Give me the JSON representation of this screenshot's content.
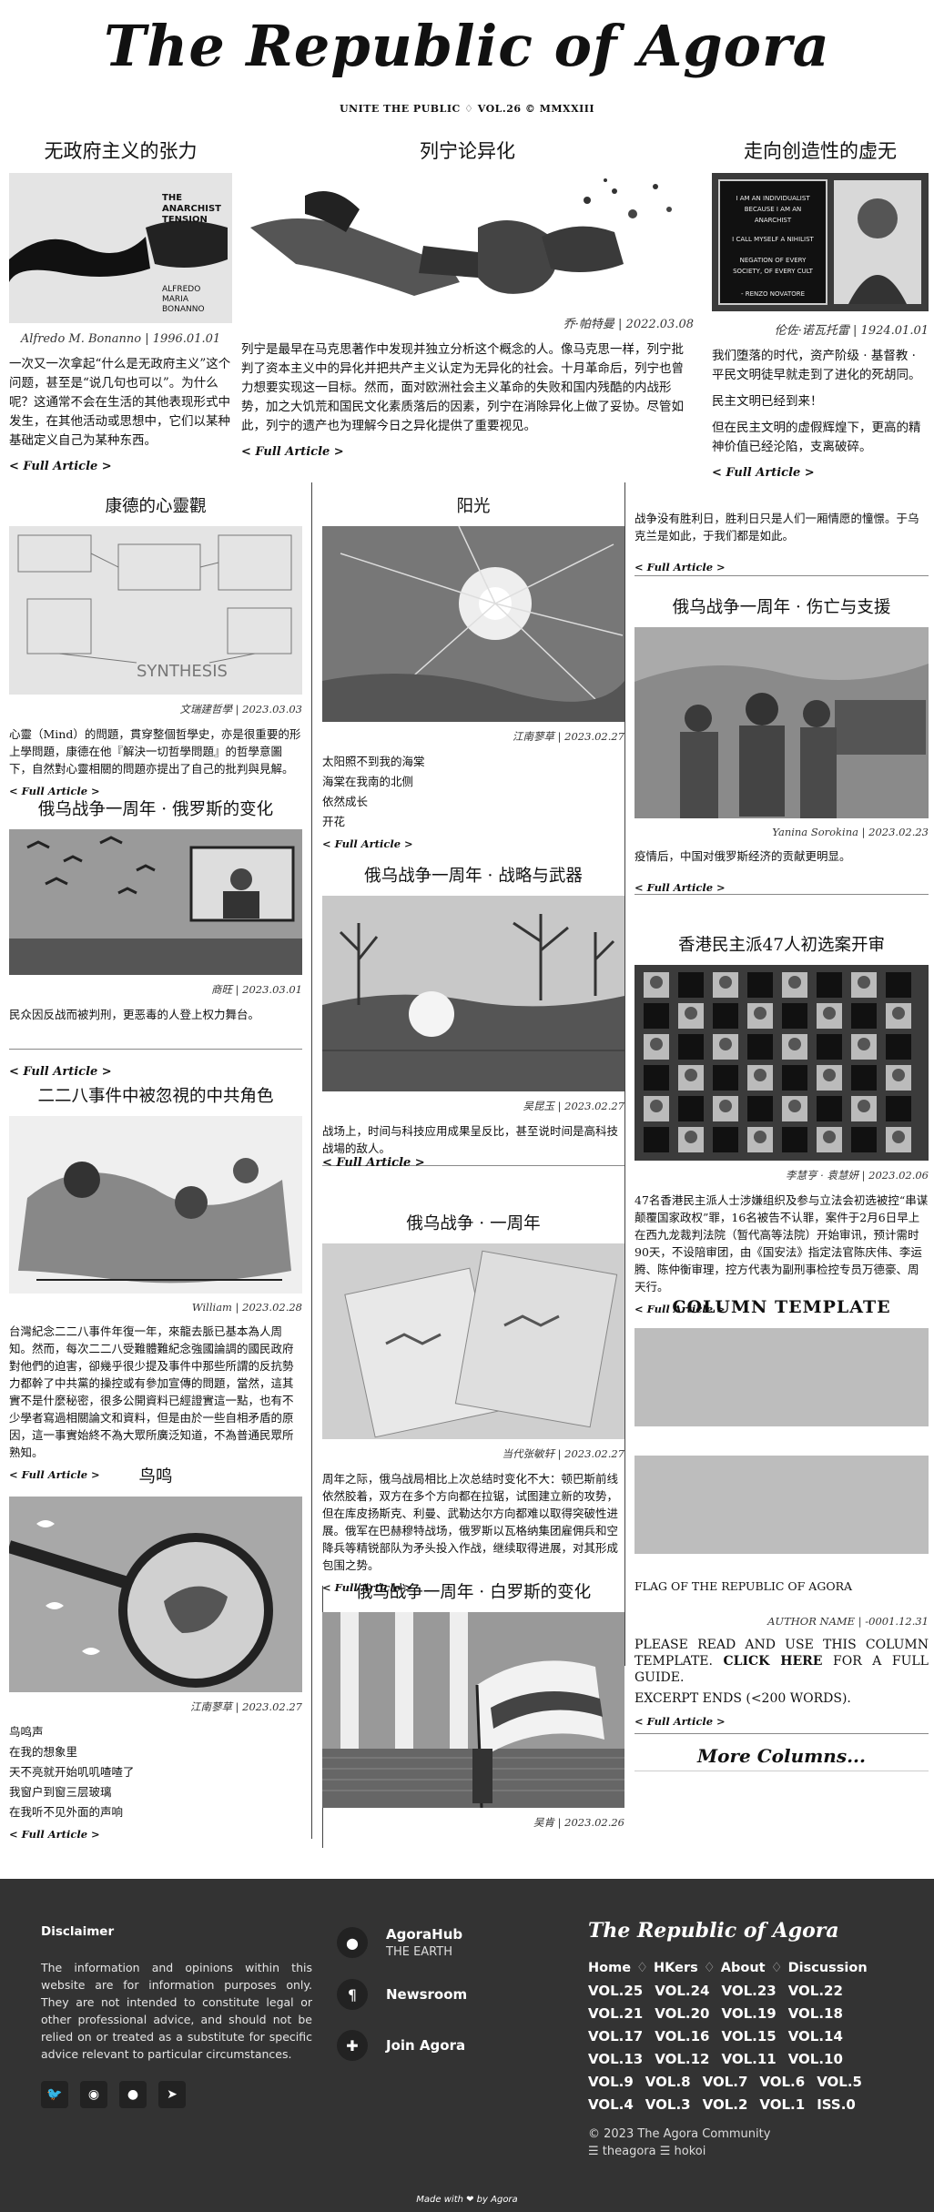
{
  "masthead": {
    "title": "The Republic of Agora",
    "subline": "UNITE THE PUBLIC ♢ VOL.26 © MMXXIII"
  },
  "top": [
    {
      "title": "无政府主义的张力",
      "byline": "Alfredo M. Bonanno | 1996.01.01",
      "text": "一次又一次拿起“什么是无政府主义”这个问题，甚至是“说几句也可以”。为什么呢？这通常不会在生活的其他表现形式中发生，在其他活动或思想中，它们以某种基础定义自己为某种东西。",
      "link": "< Full Article >",
      "img_text": "THE ANARCHIST TENSION — ALFREDO MARIA BONANNO"
    },
    {
      "title": "列宁论异化",
      "byline": "乔·帕特曼 | 2022.03.08",
      "text": "列宁是最早在马克思著作中发现并独立分析这个概念的人。像马克思一样，列宁批判了资本主义中的异化并把共产主义认定为无异化的社会。十月革命后，列宁也曾力想要实现这一目标。然而，面对欧洲社会主义革命的失败和国内残酷的内战形势，加之大饥荒和国民文化素质落后的因素，列宁在消除异化上做了妥协。尽管如此，列宁的遗产也为理解今日之异化提供了重要视见。",
      "link": "< Full Article >"
    },
    {
      "title": "走向创造性的虚无",
      "byline": "伦佐·诺瓦托雷 | 1924.01.01",
      "text1": "我们堕落的时代，资产阶级 · 基督教 · 平民文明徒早就走到了进化的死胡同。",
      "text2": "民主文明已经到来！",
      "text3": "但在民主文明的虚假辉煌下，更高的精神价值已经沦陷，支离破碎。",
      "link": "< Full Article >",
      "img_text": "I AM AN INDIVIDUALIST BECAUSE I AM AN ANARCHIST — RENZO NOVATORE"
    }
  ],
  "col1": [
    {
      "title": "康德的心靈觀",
      "credit": "文瑞建哲學 | 2023.03.03",
      "text": "心靈（Mind）的問題，貫穿整個哲學史，亦是很重要的形上學問題，康德在他『解決一切哲學問題』的哲學意圖下，自然對心靈相關的問題亦提出了自己的批判與見解。",
      "link": "< Full Article >",
      "img_text": "SYNTHESIS"
    },
    {
      "title": "俄乌战争一周年 · 俄罗斯的变化",
      "credit": "商旺 | 2023.03.01",
      "text": "民众因反战而被判刑，更恶毒的人登上权力舞台。",
      "link": "< Full Article >"
    },
    {
      "title": "二二八事件中被忽視的中共角色",
      "credit": "William | 2023.02.28",
      "text": "台灣紀念二二八事件年復一年，來龍去脈已基本為人周知。然而，每次二二八受難體難紀念強國論調的國民政府對他們的迫害，卻幾乎很少提及事件中那些所謂的反抗勢力都幹了中共黨的操控或有參加宣傳的問題，當然，這其實不是什麼秘密，很多公開資料已經證實這一點，也有不少學者寫過相關論文和資料，但是由於一些自相矛盾的原因，這一事實始終不為大眾所廣泛知道，不為普通民眾所熟知。",
      "link": "< Full Article >"
    },
    {
      "title": "鸟鸣",
      "credit": "江南蓼草 | 2023.02.27",
      "lines": [
        "鸟鸣声",
        "在我的想象里",
        "天不亮就开始叽叽喳喳了",
        "我窗户到窗三层玻璃",
        "在我听不见外面的声响"
      ],
      "link": "< Full Article >"
    }
  ],
  "col2": [
    {
      "title": "阳光",
      "credit": "江南蓼草 | 2023.02.27",
      "lines": [
        "太阳照不到我的海棠",
        "海棠在我南的北侧",
        "依然成长",
        "开花"
      ],
      "link": "< Full Article >"
    },
    {
      "title": "俄乌战争一周年 · 战略与武器",
      "credit": "吴昆玉 | 2023.02.27",
      "text": "战场上，时间与科技应用成果呈反比，甚至说时间是高科技战場的敌人。",
      "link": "< Full Article >"
    },
    {
      "title": "俄乌战争 · 一周年",
      "credit": "当代张敏轩 | 2023.02.27",
      "text": "周年之际，俄乌战局相比上次总结时变化不大：顿巴斯前线依然胶着，双方在多个方向都在拉锯，试图建立新的攻势，但在库皮扬斯克、利曼、武勒达尔方向都难以取得突破性进展。俄军在巴赫穆特战场，俄罗斯以瓦格纳集团雇佣兵和空降兵等精锐部队为矛头投入作战，继续取得进展，对其形成包围之势。",
      "link": "< Full Article >"
    },
    {
      "title": "俄乌战争一周年 · 白罗斯的变化",
      "credit": "吴肯 | 2023.02.26"
    }
  ],
  "col3": [
    {
      "text": "战争没有胜利日，胜利日只是人们一厢情愿的憧憬。于乌克兰是如此，于我们都是如此。",
      "link": "< Full Article >"
    },
    {
      "title": "俄乌战争一周年 · 伤亡与支援",
      "credit": "Yanina Sorokina | 2023.02.23",
      "text": "疫情后，中国对俄罗斯经济的贡献更明显。",
      "link": "< Full Article >"
    },
    {
      "title": "香港民主派47人初选案开审",
      "credit": "李慧亨 · 袁慧妍 | 2023.02.06",
      "text": "47名香港民主派人士涉嫌组织及参与立法会初选被控“串谋颠覆国家政权”罪，16名被告不认罪，案件于2月6日早上在西九龙裁判法院（暂代高等法院）开始审讯，预计需时90天，不设陪审团，由《国安法》指定法官陈庆伟、李运腾、陈仲衡审理，控方代表为副刑事检控专员万德豪、周天行。",
      "link": "< Full Article >"
    },
    {
      "title": "COLUMN TEMPLATE",
      "caption": "FLAG OF THE REPUBLIC OF AGORA",
      "credit": "AUTHOR NAME | -0001.12.31",
      "text_a": "PLEASE READ AND USE THIS COLUMN TEMPLATE. ",
      "text_b": "CLICK HERE",
      "text_c": " FOR A FULL GUIDE.",
      "text_d": "EXCERPT ENDS (<200 WORDS).",
      "link": "< Full Article >",
      "more": "More Columns..."
    }
  ],
  "footer": {
    "disclaimer_title": "Disclaimer",
    "disclaimer_text": "The information and opinions within this website are for information purposes only. They are not intended to constitute legal or other professional advice, and should not be relied on or treated as a substitute for specific advice relevant to particular circumstances.",
    "links": [
      {
        "label": "AgoraHub",
        "sub": "THE EARTH"
      },
      {
        "label": "Newsroom",
        "sub": ""
      },
      {
        "label": "Join Agora",
        "sub": ""
      }
    ],
    "title": "The Republic of Agora",
    "nav": [
      "Home",
      "HKers",
      "About",
      "Discussion"
    ],
    "vols": [
      "VOL.25",
      "VOL.24",
      "VOL.23",
      "VOL.22",
      "VOL.21",
      "VOL.20",
      "VOL.19",
      "VOL.18",
      "VOL.17",
      "VOL.16",
      "VOL.15",
      "VOL.14",
      "VOL.13",
      "VOL.12",
      "VOL.11",
      "VOL.10",
      "VOL.9",
      "VOL.8",
      "VOL.7",
      "VOL.6",
      "VOL.5",
      "VOL.4",
      "VOL.3",
      "VOL.2",
      "VOL.1",
      "ISS.0"
    ],
    "copyright": "© 2023 The Agora Community",
    "credits": "☰ theagora ☰ hokoi",
    "made": "Made with ❤ by Agora"
  },
  "icons": {
    "location": "map-pin-icon",
    "newsroom": "pilcrow-icon",
    "join": "puzzle-icon"
  }
}
